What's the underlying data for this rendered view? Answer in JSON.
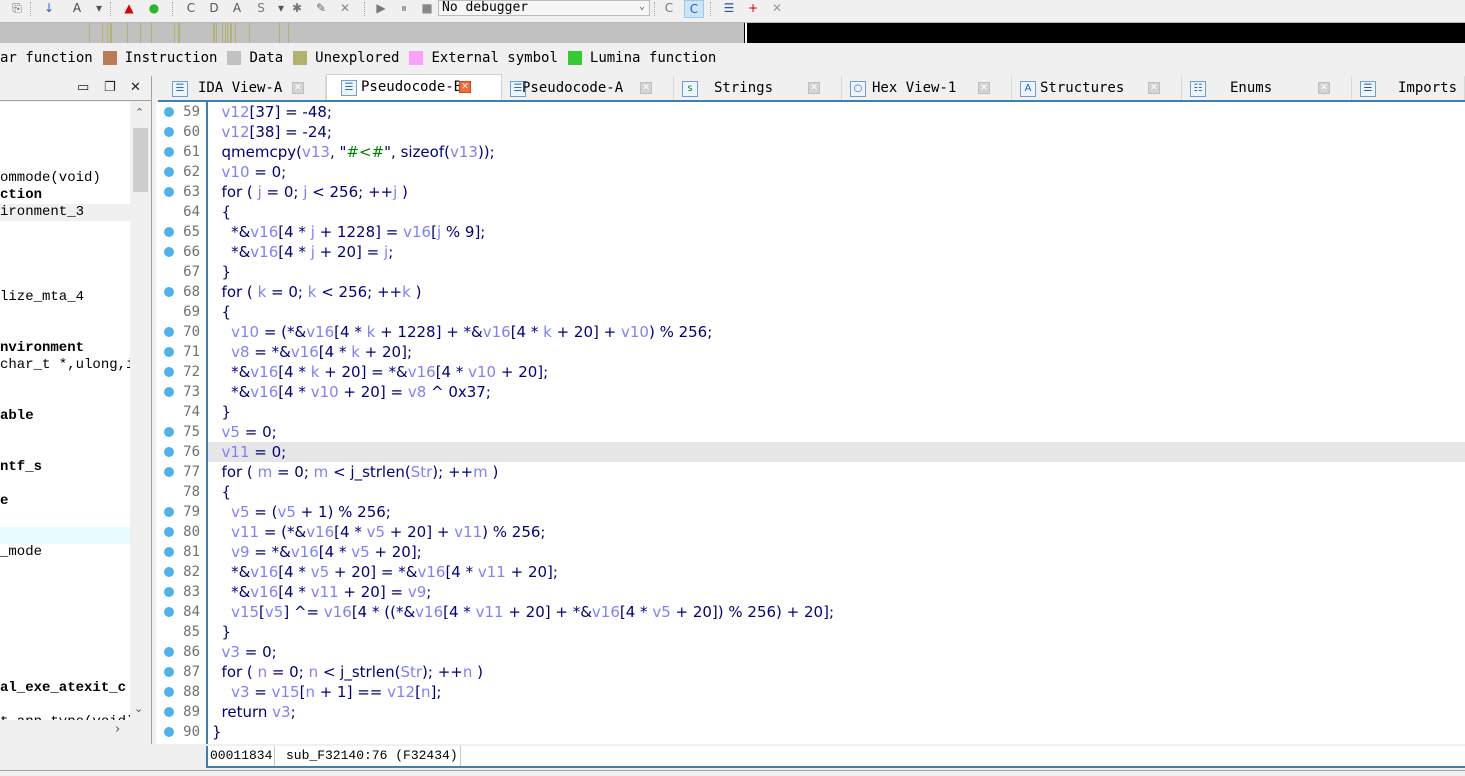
{
  "toolbar": {
    "icons": [
      {
        "name": "open-graph-icon",
        "glyph": "⎘"
      },
      {
        "name": "jump-down-icon",
        "glyph": "↓"
      },
      {
        "name": "font-icon",
        "glyph": "A"
      },
      {
        "name": "dropdown-arrow-icon",
        "glyph": "▾"
      },
      {
        "name": "warning-icon",
        "glyph": "▲"
      },
      {
        "name": "run-green-icon",
        "glyph": "●"
      },
      {
        "name": "make-code-icon",
        "glyph": "C"
      },
      {
        "name": "make-data-icon",
        "glyph": "D"
      },
      {
        "name": "make-string-icon",
        "glyph": "A"
      },
      {
        "name": "make-struct-icon",
        "glyph": "S"
      },
      {
        "name": "dropdown-arrow-icon",
        "glyph": "▾"
      },
      {
        "name": "make-array-icon",
        "glyph": "✱"
      },
      {
        "name": "rename-icon",
        "glyph": "✎"
      },
      {
        "name": "undefine-icon",
        "glyph": "✕"
      },
      {
        "name": "start-debug-icon",
        "glyph": "▶"
      },
      {
        "name": "pause-icon",
        "glyph": "⏸"
      },
      {
        "name": "stop-icon",
        "glyph": "■"
      }
    ],
    "debugger_selected": "No debugger",
    "right_icons": [
      {
        "name": "decompile-icon",
        "glyph": "C"
      },
      {
        "name": "decompile-run-icon",
        "glyph": "C"
      },
      {
        "name": "breakpoint-list-icon",
        "glyph": "☰"
      },
      {
        "name": "add-breakpoint-icon",
        "glyph": "+"
      },
      {
        "name": "delete-breakpoint-icon",
        "glyph": "✕"
      }
    ]
  },
  "legend": [
    {
      "label": "ar function",
      "color": null
    },
    {
      "label": "Instruction",
      "color": "#b97a57"
    },
    {
      "label": "Data",
      "color": "#c0c0c0"
    },
    {
      "label": "Unexplored",
      "color": "#b2b36a"
    },
    {
      "label": "External symbol",
      "color": "#ffa0ff"
    },
    {
      "label": "Lumina function",
      "color": "#33cc33"
    }
  ],
  "left_panel": {
    "header_buttons": [
      {
        "name": "maximize-icon",
        "glyph": "▭"
      },
      {
        "name": "restore-icon",
        "glyph": "❐"
      },
      {
        "name": "close-icon",
        "glyph": "✕"
      }
    ],
    "items": [
      {
        "text": "ommode(void)",
        "bold": false
      },
      {
        "text": "ction",
        "bold": true
      },
      {
        "text": "ironment_3",
        "bold": false
      },
      {
        "text": "lize_mta_4",
        "bold": false
      },
      {
        "text": "nvironment",
        "bold": true
      },
      {
        "text": "char_t *,ulong,i",
        "bold": false
      },
      {
        "text": "able",
        "bold": true
      },
      {
        "text": "ntf_s",
        "bold": true
      },
      {
        "text": "e",
        "bold": true
      },
      {
        "text": "_mode",
        "bold": false
      },
      {
        "text": "al_exe_atexit_c",
        "bold": true
      },
      {
        "text": "t_app_type(void)",
        "bold": false
      }
    ]
  },
  "tabs": [
    {
      "label": "IDA View-A",
      "icon": "ida-view-icon",
      "active": false
    },
    {
      "label": "Pseudocode-B",
      "icon": "pseudocode-icon",
      "active": true
    },
    {
      "label": "Pseudocode-A",
      "icon": "pseudocode-icon",
      "active": false
    },
    {
      "label": "Strings",
      "icon": "strings-icon",
      "active": false
    },
    {
      "label": "Hex View-1",
      "icon": "hex-view-icon",
      "active": false
    },
    {
      "label": "Structures",
      "icon": "structures-icon",
      "active": false
    },
    {
      "label": "Enums",
      "icon": "enums-icon",
      "active": false
    },
    {
      "label": "Imports",
      "icon": "imports-icon",
      "active": false
    }
  ],
  "code": {
    "highlighted_line": 76,
    "lines": [
      {
        "n": 59,
        "bp": true,
        "t": "  v12[37] = -48;"
      },
      {
        "n": 60,
        "bp": true,
        "t": "  v12[38] = -24;"
      },
      {
        "n": 61,
        "bp": true,
        "t": "  qmemcpy(v13, \"#<#\", sizeof(v13));"
      },
      {
        "n": 62,
        "bp": true,
        "t": "  v10 = 0;"
      },
      {
        "n": 63,
        "bp": true,
        "t": "  for ( j = 0; j < 256; ++j )"
      },
      {
        "n": 64,
        "bp": false,
        "t": "  {"
      },
      {
        "n": 65,
        "bp": true,
        "t": "    *&v16[4 * j + 1228] = v16[j % 9];"
      },
      {
        "n": 66,
        "bp": true,
        "t": "    *&v16[4 * j + 20] = j;"
      },
      {
        "n": 67,
        "bp": false,
        "t": "  }"
      },
      {
        "n": 68,
        "bp": true,
        "t": "  for ( k = 0; k < 256; ++k )"
      },
      {
        "n": 69,
        "bp": false,
        "t": "  {"
      },
      {
        "n": 70,
        "bp": true,
        "t": "    v10 = (*&v16[4 * k + 1228] + *&v16[4 * k + 20] + v10) % 256;"
      },
      {
        "n": 71,
        "bp": true,
        "t": "    v8 = *&v16[4 * k + 20];"
      },
      {
        "n": 72,
        "bp": true,
        "t": "    *&v16[4 * k + 20] = *&v16[4 * v10 + 20];"
      },
      {
        "n": 73,
        "bp": true,
        "t": "    *&v16[4 * v10 + 20] = v8 ^ 0x37;"
      },
      {
        "n": 74,
        "bp": false,
        "t": "  }"
      },
      {
        "n": 75,
        "bp": true,
        "t": "  v5 = 0;"
      },
      {
        "n": 76,
        "bp": true,
        "t": "  v11 = 0;"
      },
      {
        "n": 77,
        "bp": true,
        "t": "  for ( m = 0; m < j_strlen(Str); ++m )"
      },
      {
        "n": 78,
        "bp": false,
        "t": "  {"
      },
      {
        "n": 79,
        "bp": true,
        "t": "    v5 = (v5 + 1) % 256;"
      },
      {
        "n": 80,
        "bp": true,
        "t": "    v11 = (*&v16[4 * v5 + 20] + v11) % 256;"
      },
      {
        "n": 81,
        "bp": true,
        "t": "    v9 = *&v16[4 * v5 + 20];"
      },
      {
        "n": 82,
        "bp": true,
        "t": "    *&v16[4 * v5 + 20] = *&v16[4 * v11 + 20];"
      },
      {
        "n": 83,
        "bp": true,
        "t": "    *&v16[4 * v11 + 20] = v9;"
      },
      {
        "n": 84,
        "bp": true,
        "t": "    v15[v5] ^= v16[4 * ((*&v16[4 * v11 + 20] + *&v16[4 * v5 + 20]) % 256) + 20];"
      },
      {
        "n": 85,
        "bp": false,
        "t": "  }"
      },
      {
        "n": 86,
        "bp": true,
        "t": "  v3 = 0;"
      },
      {
        "n": 87,
        "bp": true,
        "t": "  for ( n = 0; n < j_strlen(Str); ++n )"
      },
      {
        "n": 88,
        "bp": true,
        "t": "    v3 = v15[n + 1] == v12[n];"
      },
      {
        "n": 89,
        "bp": true,
        "t": "  return v3;"
      },
      {
        "n": 90,
        "bp": true,
        "t": "}"
      }
    ],
    "variables": [
      "v12",
      "v13",
      "v10",
      "v16",
      "v8",
      "v5",
      "v11",
      "v9",
      "v15",
      "v3",
      "j",
      "k",
      "m",
      "n",
      "Str"
    ]
  },
  "status": {
    "offset": "00011834",
    "location": "sub_F32140:76 (F32434)"
  }
}
